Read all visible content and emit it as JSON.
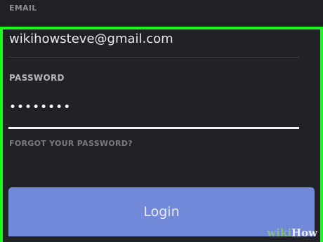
{
  "form": {
    "email_label": "EMAIL",
    "email_value": "wikihowsteve@gmail.com",
    "password_label": "PASSWORD",
    "password_value": "••••••••",
    "forgot_link": "FORGOT YOUR PASSWORD?",
    "login_button": "Login"
  },
  "watermark": {
    "wiki": "wiki",
    "how": "How"
  },
  "colors": {
    "background": "#202225",
    "highlight": "#1ff51f",
    "button": "#7289da"
  }
}
